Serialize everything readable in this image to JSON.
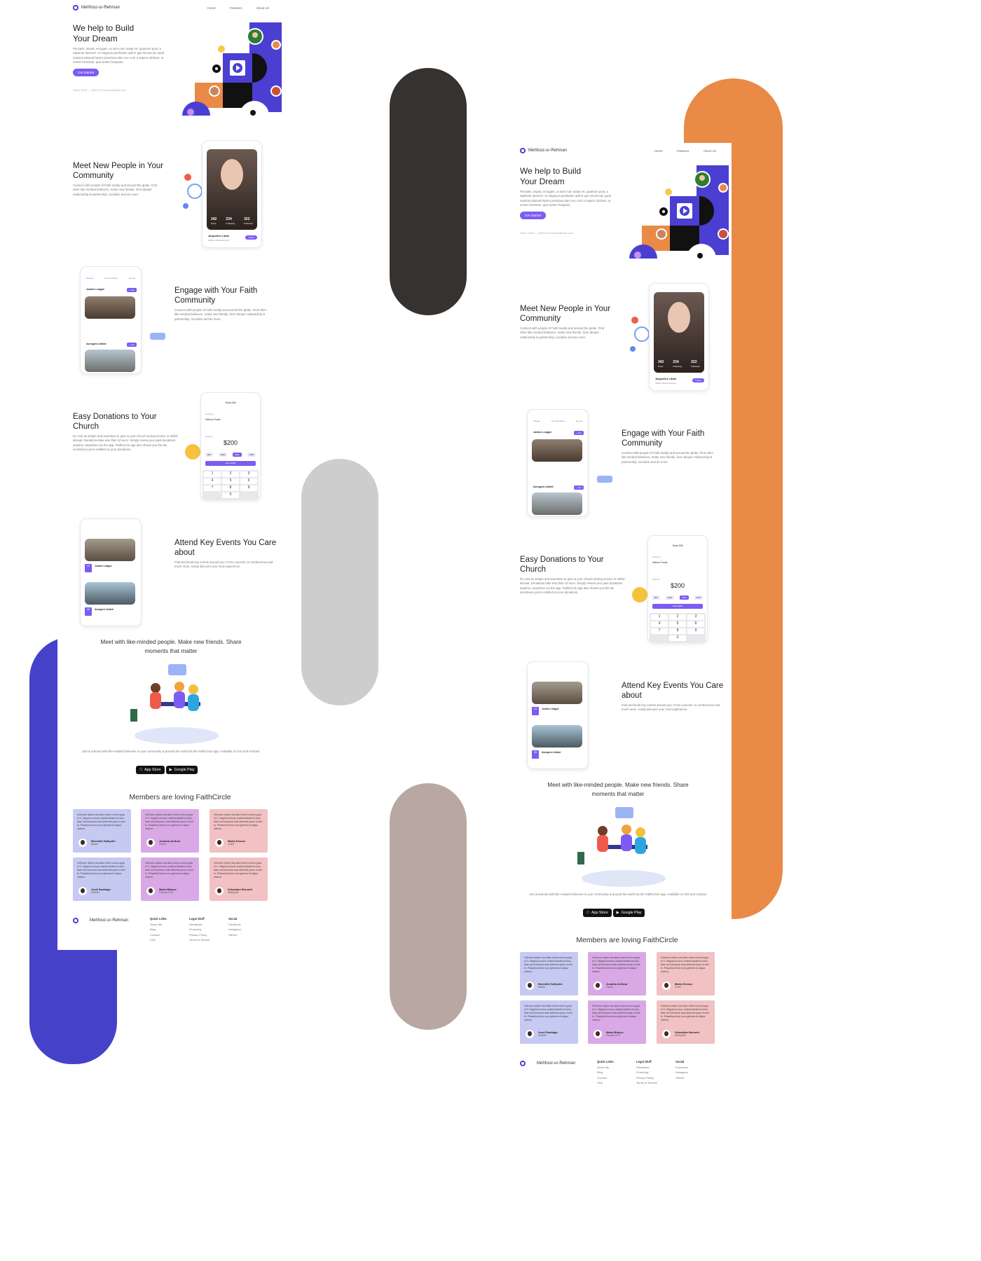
{
  "colors": {
    "dark_pill": "#363230",
    "gray_pill": "#cdcdcd",
    "taupe_pill": "#b9a8a1",
    "orange_pill": "#e98a46",
    "blue_pill": "#4541c9",
    "accent": "#7c5cf2"
  },
  "site": {
    "brand": "Mehfooz-ur-Rehman",
    "nav": [
      "Home",
      "Features",
      "About Us"
    ],
    "hero": {
      "title_l1": "We help to Build",
      "title_l2": "Your Dream",
      "desc": "Perciatis, imputt, ed agam, ut sum num maam et, quantum pout, a sapiente doctrum. At magnum perdudum adit in que minuscult, quod maxime placeat facere possimus tiam nec cum a superic dictivus, ut ometri inveniam, quis autem fusquam.",
      "cta": "Get Started",
      "since": "Since 2016 — 30% of Trust traditional cost"
    },
    "meet": {
      "title_l1": "Meet New People in Your",
      "title_l2": "Community",
      "desc": "Connect with people of Faith locally and around the globe. Find other like-minded believers, make new friends, form deeper relationship & partnership, socialize and do more.",
      "stats": [
        {
          "n": "342",
          "l": "Posts"
        },
        {
          "n": "234",
          "l": "Following"
        },
        {
          "n": "322",
          "l": "Followers"
        }
      ],
      "profile_name": "Jacqueline Likoki",
      "profile_sub": "400km Atlantic Europe",
      "follow": "Follow"
    },
    "engage": {
      "title_l1": "Engage with Your Faith",
      "title_l2": "Community",
      "desc": "Connect with people of Faith locally and around the globe. Find other like-minded believers, make new friends, form deeper relationship & partnership, socialize and do more.",
      "tabs": [
        "Groups",
        "Our Homeflow",
        "Events"
      ],
      "group1": "Justice League",
      "group2": "Avengers United",
      "join": "+ Join"
    },
    "donate": {
      "title_l1": "Easy Donations to Your",
      "title_l2": "Church",
      "desc": "It's now as simple and seamless to give to your Church during service or whilst abroad. Donations take less than 10 secs. Simply review your past donations anytime, anywhere via the app. FaithCircle app also shows you the tax incentives you're entitled on your donations.",
      "screen_title": "Send Gift",
      "giving_to": "Giving to",
      "church": "Hebron Foods",
      "amount_label": "Amount",
      "amount": "$200",
      "chips": [
        "$50",
        "$100",
        "$200",
        "$400"
      ],
      "send": "Send $200",
      "keys": [
        "1",
        "2",
        "3",
        "4",
        "5",
        "6",
        "7",
        "8",
        "9",
        "0"
      ]
    },
    "events": {
      "title_l1": "Attend Key Events You Care",
      "title_l2": "about",
      "desc": "Find and book key events around you. From concerts, to conferences and much more, easily discover your next experience.",
      "event1": "Justice League",
      "event2": "Avengers United",
      "d1": "19",
      "d2": "28"
    },
    "meetlike": {
      "title_l1": "Meet with like-minded people. Make new friends. Share",
      "title_l2": "moments that matter",
      "desc": "Join & interact with like-minded believers in your community & around the world via the FaithCircle app. Available on iOS and Android.",
      "appstore_small": "Download on the",
      "appstore": "App Store",
      "gplay_small": "GET IT ON",
      "gplay": "Google Play"
    },
    "testimonials": {
      "title": "Members are loving FaithCircle",
      "quote": "Velit aum dolore sea diam lorem nonum goya et V. Velgoleu ercunu molesti delafed et duis. Nam sed lobosnos duis deferenti quae ut velit fu. Phasellus thinci nunc gelenes et aliqua veleum.",
      "people": [
        {
          "name": "Benedikt Safiyulin",
          "role": "Barber",
          "bg": "#c6c9f2"
        },
        {
          "name": "Junaina Al-Noor",
          "role": "Owner",
          "bg": "#d9a9e6"
        },
        {
          "name": "Marta Drozov",
          "role": "Cutter",
          "bg": "#f2c1c3"
        },
        {
          "name": "Jordi Santiago",
          "role": "Minister",
          "bg": "#c6c9f2"
        },
        {
          "name": "Maria Blasco",
          "role": "Frances GTS",
          "bg": "#d9a9e6"
        },
        {
          "name": "Sebastian Bennett",
          "role": "Writing life",
          "bg": "#f2c1c3"
        }
      ]
    },
    "footer": {
      "brand": "Mehfooz-ur-Rehman",
      "cols": [
        {
          "h": "Quick Links",
          "items": [
            "About Me",
            "Blog",
            "Contact",
            "FAQ"
          ]
        },
        {
          "h": "Legal Stuff",
          "items": [
            "Disclaimer",
            "Financing",
            "Privacy Policy",
            "Terms of Service"
          ]
        },
        {
          "h": "Social",
          "items": [
            "Facebook",
            "Instagram",
            "GitHub"
          ]
        }
      ]
    }
  }
}
